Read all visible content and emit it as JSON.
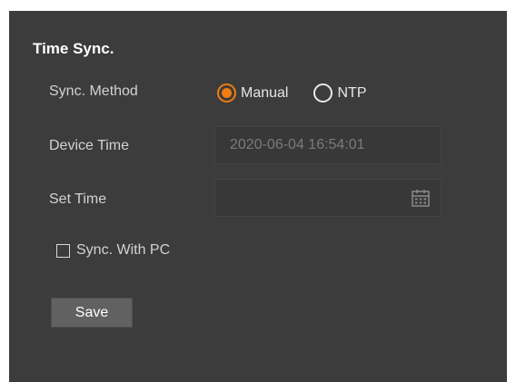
{
  "section": {
    "title": "Time Sync."
  },
  "sync_method": {
    "label": "Sync. Method",
    "options": [
      {
        "label": "Manual",
        "selected": true
      },
      {
        "label": "NTP",
        "selected": false
      }
    ]
  },
  "device_time": {
    "label": "Device Time",
    "value": "2020-06-04 16:54:01"
  },
  "set_time": {
    "label": "Set Time",
    "value": "",
    "icon": "calendar-icon"
  },
  "sync_with_pc": {
    "label": "Sync. With PC",
    "checked": false
  },
  "save_button": {
    "label": "Save"
  },
  "colors": {
    "panel_background": "#3c3c3c",
    "accent": "#f07d0f",
    "button_background": "#616161"
  }
}
